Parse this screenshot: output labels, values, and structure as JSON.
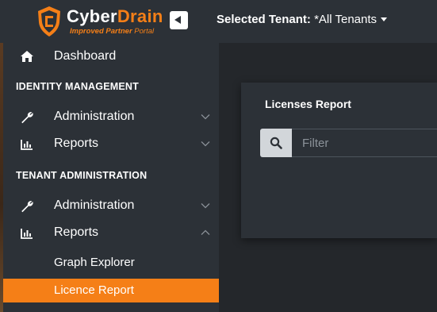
{
  "header": {
    "brand_part1": "Cyber",
    "brand_part2": "Drain",
    "tagline_part1": "Improved Partner",
    "tagline_part2": " Portal",
    "tenant_label": "Selected Tenant:",
    "tenant_value": " *All Tenants"
  },
  "sidebar": {
    "dashboard": {
      "label": "Dashboard",
      "icon": "home-icon"
    },
    "sections": [
      {
        "title": "IDENTITY MANAGEMENT",
        "items": [
          {
            "label": "Administration",
            "icon": "wrench-icon",
            "expanded": false
          },
          {
            "label": "Reports",
            "icon": "bar-chart-icon",
            "expanded": false
          }
        ]
      },
      {
        "title": "TENANT ADMINISTRATION",
        "items": [
          {
            "label": "Administration",
            "icon": "wrench-icon",
            "expanded": false
          },
          {
            "label": "Reports",
            "icon": "bar-chart-icon",
            "expanded": true
          }
        ],
        "sub_items": [
          {
            "label": "Graph Explorer",
            "active": false
          },
          {
            "label": "Licence Report",
            "active": true
          }
        ]
      }
    ]
  },
  "main": {
    "card_title": "Licenses Report",
    "filter": {
      "placeholder": "Filter",
      "value": "",
      "icon": "search-icon"
    }
  },
  "colors": {
    "accent": "#f57f17",
    "sidebar_bg": "#2c3137",
    "content_bg": "#24272b"
  }
}
